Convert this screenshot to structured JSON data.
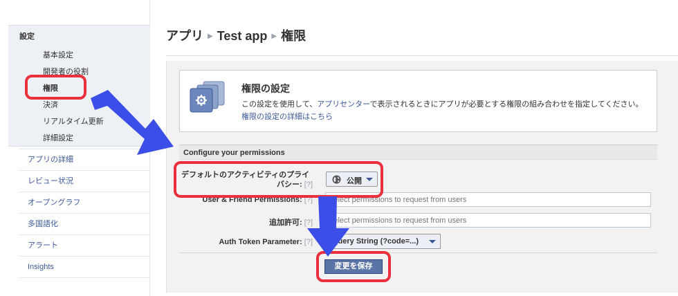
{
  "breadcrumb": [
    "アプリ",
    "Test app",
    "権限"
  ],
  "breadcrumb_sep": "▶",
  "sidebar": {
    "settings_heading": "設定",
    "sub_items": [
      "基本設定",
      "開発者の役割",
      "権限",
      "決済",
      "リアルタイム更新",
      "詳細設定"
    ],
    "active_sub_item": "権限",
    "items": [
      "アプリの詳細",
      "レビュー状況",
      "オープングラフ",
      "多国語化",
      "アラート",
      "Insights"
    ]
  },
  "intro": {
    "title": "権限の設定",
    "desc_before": "この設定を使用して、",
    "desc_link": "アプリセンター",
    "desc_after": "で表示されるときにアプリが必要とする権限の組み合わせを指定してください。",
    "detail_link": "権限の設定の詳細はこちら"
  },
  "form": {
    "section_title": "Configure your permissions",
    "help": "[?]",
    "privacy_label_line1": "デフォルトのアクティビティのプライ",
    "privacy_label_line2": "バシー:",
    "privacy_value": "公開",
    "user_friend_label": "User & Friend Permissions:",
    "user_friend_placeholder": "Select permissions to request from users",
    "extended_label": "追加許可:",
    "extended_placeholder": "Select permissions to request from users",
    "auth_token_label": "Auth Token Parameter:",
    "auth_token_value": "Query String (?code=...)",
    "save_label": "変更を保存"
  },
  "colors": {
    "link": "#3b5998",
    "annotation_red": "#e9303c",
    "annotation_arrow": "#3c4ee8",
    "save_button": "#5b74a8"
  },
  "icons": [
    "permissions-stack-icon",
    "globe-icon",
    "chevron-down-icon",
    "arrow-annotation"
  ]
}
